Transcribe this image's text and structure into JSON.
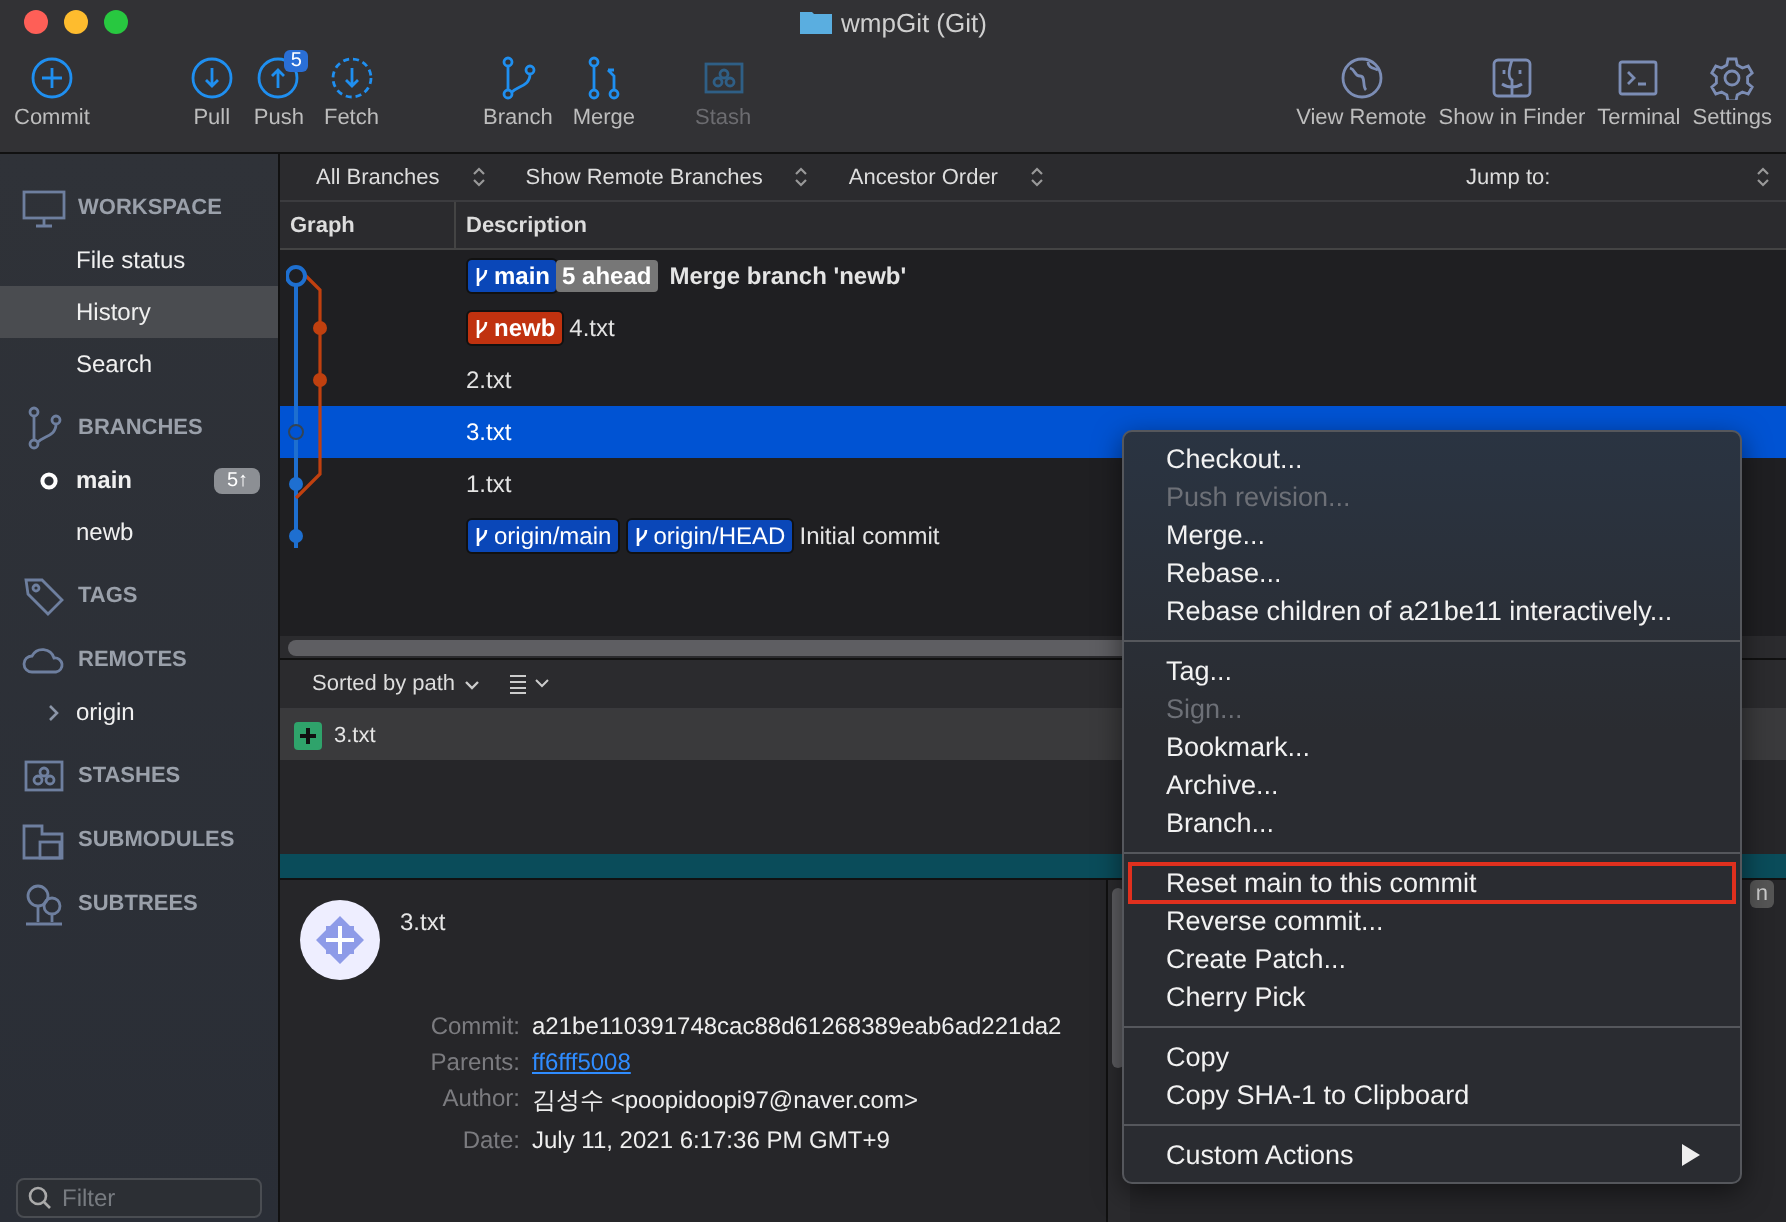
{
  "window": {
    "title": "wmpGit (Git)"
  },
  "toolbar": {
    "left": [
      {
        "label": "Commit",
        "kind": "commit",
        "disabled": false
      },
      {
        "label": "Pull",
        "kind": "pull",
        "disabled": false
      },
      {
        "label": "Push",
        "kind": "push",
        "disabled": false,
        "badge": "5"
      },
      {
        "label": "Fetch",
        "kind": "fetch",
        "disabled": false
      },
      {
        "label": "Branch",
        "kind": "branch",
        "disabled": false
      },
      {
        "label": "Merge",
        "kind": "merge",
        "disabled": false
      },
      {
        "label": "Stash",
        "kind": "stash",
        "disabled": true
      }
    ],
    "right": [
      {
        "label": "View Remote",
        "kind": "globe"
      },
      {
        "label": "Show in Finder",
        "kind": "finder"
      },
      {
        "label": "Terminal",
        "kind": "terminal"
      },
      {
        "label": "Settings",
        "kind": "settings"
      }
    ]
  },
  "sidebar": {
    "sections": [
      {
        "title": "WORKSPACE",
        "kind": "workspace",
        "items": [
          {
            "label": "File status",
            "selected": false
          },
          {
            "label": "History",
            "selected": true
          },
          {
            "label": "Search",
            "selected": false
          }
        ]
      },
      {
        "title": "BRANCHES",
        "kind": "branch",
        "items": [
          {
            "label": "main",
            "selected": false,
            "current": true,
            "badge": "5↑"
          },
          {
            "label": "newb",
            "selected": false,
            "current": false
          }
        ]
      },
      {
        "title": "TAGS",
        "kind": "tag"
      },
      {
        "title": "REMOTES",
        "kind": "cloud",
        "items": [
          {
            "label": "origin",
            "selected": false,
            "expanded": false
          }
        ]
      },
      {
        "title": "STASHES",
        "kind": "stash"
      },
      {
        "title": "SUBMODULES",
        "kind": "submodule"
      },
      {
        "title": "SUBTREES",
        "kind": "tree"
      }
    ],
    "filter": {
      "placeholder": "Filter"
    }
  },
  "filter_bar": [
    "All Branches",
    "Show Remote Branches",
    "Ancestor Order"
  ],
  "jump_to": "Jump to:",
  "table": {
    "columns": [
      "Graph",
      "Description"
    ],
    "rows": [
      {
        "refs": [
          {
            "name": "main",
            "kind": "local",
            "color": "#0a47b8"
          }
        ],
        "ahead": "5 ahead",
        "message": "Merge branch 'newb'",
        "bold": true,
        "selected": false
      },
      {
        "refs": [
          {
            "name": "newb",
            "kind": "local",
            "color": "#c0320f"
          }
        ],
        "message": "4.txt",
        "bold": false,
        "selected": false
      },
      {
        "message": "2.txt",
        "bold": false,
        "selected": false
      },
      {
        "message": "3.txt",
        "bold": false,
        "selected": true
      },
      {
        "message": "1.txt",
        "bold": false,
        "selected": false
      },
      {
        "refs": [
          {
            "name": "origin/main",
            "kind": "remote",
            "color": "#0a47b8"
          },
          {
            "name": "origin/HEAD",
            "kind": "remote",
            "color": "#0a47b8"
          }
        ],
        "message": "Initial commit",
        "bold": false,
        "selected": false
      }
    ]
  },
  "files": {
    "sort": "Sorted by path",
    "items": [
      {
        "name": "3.txt",
        "kind": "added"
      }
    ]
  },
  "details": {
    "title": "3.txt",
    "fields": [
      {
        "label": "Commit:",
        "value": "a21be110391748cac88d61268389eab6ad221da2",
        "link": false
      },
      {
        "label": "Parents:",
        "value": "ff6fff5008",
        "link": true
      },
      {
        "label": "Author:",
        "value": "김성수 <poopidoopi97@naver.com>",
        "link": false
      },
      {
        "label": "Date:",
        "value": "July 11, 2021 6:17:36 PM GMT+9",
        "link": false
      }
    ]
  },
  "partial_button": "n",
  "context_menu": {
    "groups": [
      [
        {
          "label": "Checkout...",
          "disabled": false
        },
        {
          "label": "Push revision...",
          "disabled": true
        },
        {
          "label": "Merge...",
          "disabled": false
        },
        {
          "label": "Rebase...",
          "disabled": false
        },
        {
          "label": "Rebase children of a21be11 interactively...",
          "disabled": false
        }
      ],
      [
        {
          "label": "Tag...",
          "disabled": false
        },
        {
          "label": "Sign...",
          "disabled": true
        },
        {
          "label": "Bookmark...",
          "disabled": false
        },
        {
          "label": "Archive...",
          "disabled": false
        },
        {
          "label": "Branch...",
          "disabled": false
        }
      ],
      [
        {
          "label": "Reset main to this commit",
          "disabled": false,
          "highlighted": true
        },
        {
          "label": "Reverse commit...",
          "disabled": false
        },
        {
          "label": "Create Patch...",
          "disabled": false
        },
        {
          "label": "Cherry Pick",
          "disabled": false
        }
      ],
      [
        {
          "label": "Copy",
          "disabled": false
        },
        {
          "label": "Copy SHA-1 to Clipboard",
          "disabled": false
        }
      ],
      [
        {
          "label": "Custom Actions",
          "disabled": false,
          "submenu": true
        }
      ]
    ]
  }
}
